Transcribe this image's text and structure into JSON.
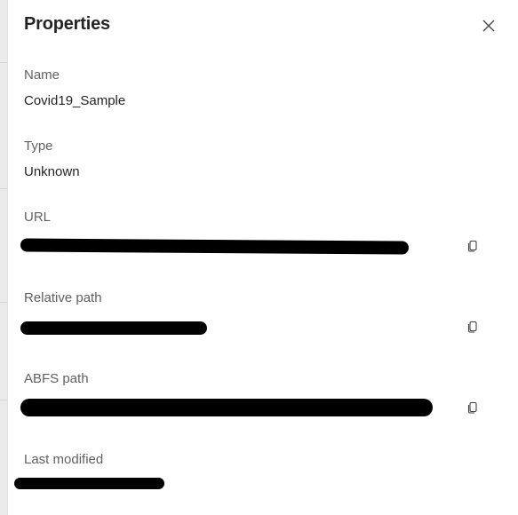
{
  "panel": {
    "title": "Properties",
    "close_icon": "close-icon",
    "fields": [
      {
        "label": "Name",
        "value": "Covid19_Sample"
      },
      {
        "label": "Type",
        "value": "Unknown"
      },
      {
        "label": "URL",
        "redacted": true,
        "copy_icon": "copy-icon"
      },
      {
        "label": "Relative path",
        "redacted": true,
        "copy_icon": "copy-icon"
      },
      {
        "label": "ABFS path",
        "redacted": true,
        "copy_icon": "copy-icon"
      },
      {
        "label": "Last modified",
        "redacted": true
      }
    ]
  }
}
